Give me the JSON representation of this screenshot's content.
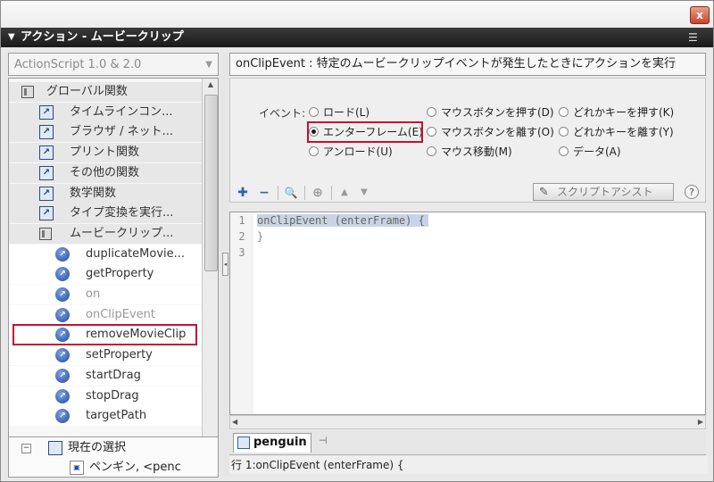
{
  "window": {
    "panel_title": "アクション - ムービークリップ",
    "close_glyph": "x",
    "options_glyph": "☰"
  },
  "left": {
    "language_combo": "ActionScript 1.0 & 2.0",
    "tree": [
      {
        "label": "グローバル関数",
        "kind": "book",
        "level": 0,
        "dim": false
      },
      {
        "label": "タイムラインコン...",
        "kind": "cat",
        "level": 1,
        "dim": false
      },
      {
        "label": "ブラウザ / ネット...",
        "kind": "cat",
        "level": 1,
        "dim": false
      },
      {
        "label": "プリント関数",
        "kind": "cat",
        "level": 1,
        "dim": false
      },
      {
        "label": "その他の関数",
        "kind": "cat",
        "level": 1,
        "dim": false
      },
      {
        "label": "数学関数",
        "kind": "cat",
        "level": 1,
        "dim": false
      },
      {
        "label": "タイプ変換を実行...",
        "kind": "cat",
        "level": 1,
        "dim": false
      },
      {
        "label": "ムービークリップ...",
        "kind": "book",
        "level": 1,
        "dim": false
      },
      {
        "label": "duplicateMovie...",
        "kind": "fn",
        "level": 2,
        "dim": false
      },
      {
        "label": "getProperty",
        "kind": "fn",
        "level": 2,
        "dim": false
      },
      {
        "label": "on",
        "kind": "fn",
        "level": 2,
        "dim": true
      },
      {
        "label": "onClipEvent",
        "kind": "fn",
        "level": 2,
        "dim": true
      },
      {
        "label": "removeMovieClip",
        "kind": "fn",
        "level": 2,
        "dim": false
      },
      {
        "label": "setProperty",
        "kind": "fn",
        "level": 2,
        "dim": false
      },
      {
        "label": "startDrag",
        "kind": "fn",
        "level": 2,
        "dim": false
      },
      {
        "label": "stopDrag",
        "kind": "fn",
        "level": 2,
        "dim": false
      },
      {
        "label": "targetPath",
        "kind": "fn",
        "level": 2,
        "dim": false
      }
    ],
    "selection_tree": {
      "current_selection": "現在の選択",
      "item": "ペンギン, <penc"
    }
  },
  "right": {
    "description": "onClipEvent : 特定のムービークリップイベントが発生したときにアクションを実行",
    "event_label": "イベント:",
    "events": [
      {
        "label": "ロード(L)",
        "checked": false
      },
      {
        "label": "エンターフレーム(E)",
        "checked": true
      },
      {
        "label": "アンロード(U)",
        "checked": false
      },
      {
        "label": "マウスボタンを押す(D)",
        "checked": false
      },
      {
        "label": "マウスボタンを離す(O)",
        "checked": false
      },
      {
        "label": "マウス移動(M)",
        "checked": false
      },
      {
        "label": "どれかキーを押す(K)",
        "checked": false
      },
      {
        "label": "どれかキーを離す(Y)",
        "checked": false
      },
      {
        "label": "データ(A)",
        "checked": false
      }
    ],
    "toolbar": {
      "add_glyph": "✚",
      "remove_glyph": "−",
      "find_glyph": "🔍",
      "target_glyph": "⊕",
      "up_glyph": "▲",
      "down_glyph": "▼",
      "script_assist": "スクリプトアシスト",
      "help_glyph": "?"
    },
    "code_lines": [
      "onClipEvent (enterFrame) {",
      "}",
      ""
    ],
    "line_numbers": [
      "1",
      "2",
      "3"
    ],
    "tab_label": "penguin",
    "status": "行 1:onClipEvent (enterFrame) {"
  },
  "colors": {
    "highlight": "#c8102e",
    "titlebar": "#1a1a1a"
  }
}
